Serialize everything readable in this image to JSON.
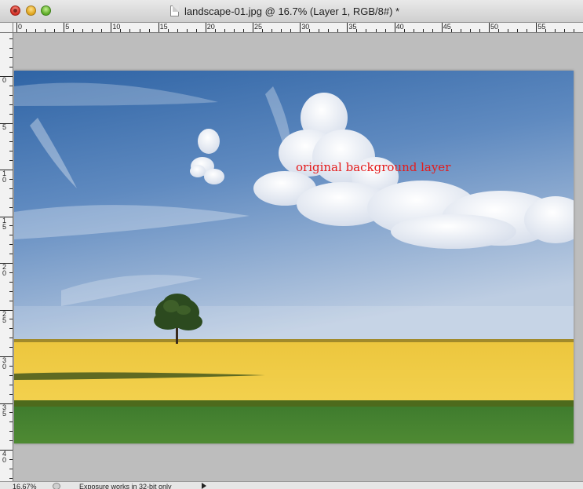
{
  "window": {
    "title": "landscape-01.jpg @ 16.7% (Layer 1, RGB/8#) *"
  },
  "rulers": {
    "top_labels": [
      "0",
      "5",
      "10",
      "15",
      "20",
      "25",
      "30",
      "35",
      "40",
      "45",
      "50",
      "55"
    ],
    "left_labels": [
      "0",
      "5",
      "10",
      "15",
      "20",
      "25",
      "30",
      "35",
      "40"
    ]
  },
  "canvas": {
    "text_layer": "original background layer",
    "text_color": "#e51b1b"
  },
  "status_bar": {
    "zoom": "16.67%",
    "message": "Exposure works in 32-bit only"
  },
  "icons": {
    "close": "close-icon",
    "minimize": "minimize-icon",
    "zoom": "zoom-icon",
    "document": "document-icon",
    "status_menu": "status-menu-arrow-icon"
  }
}
